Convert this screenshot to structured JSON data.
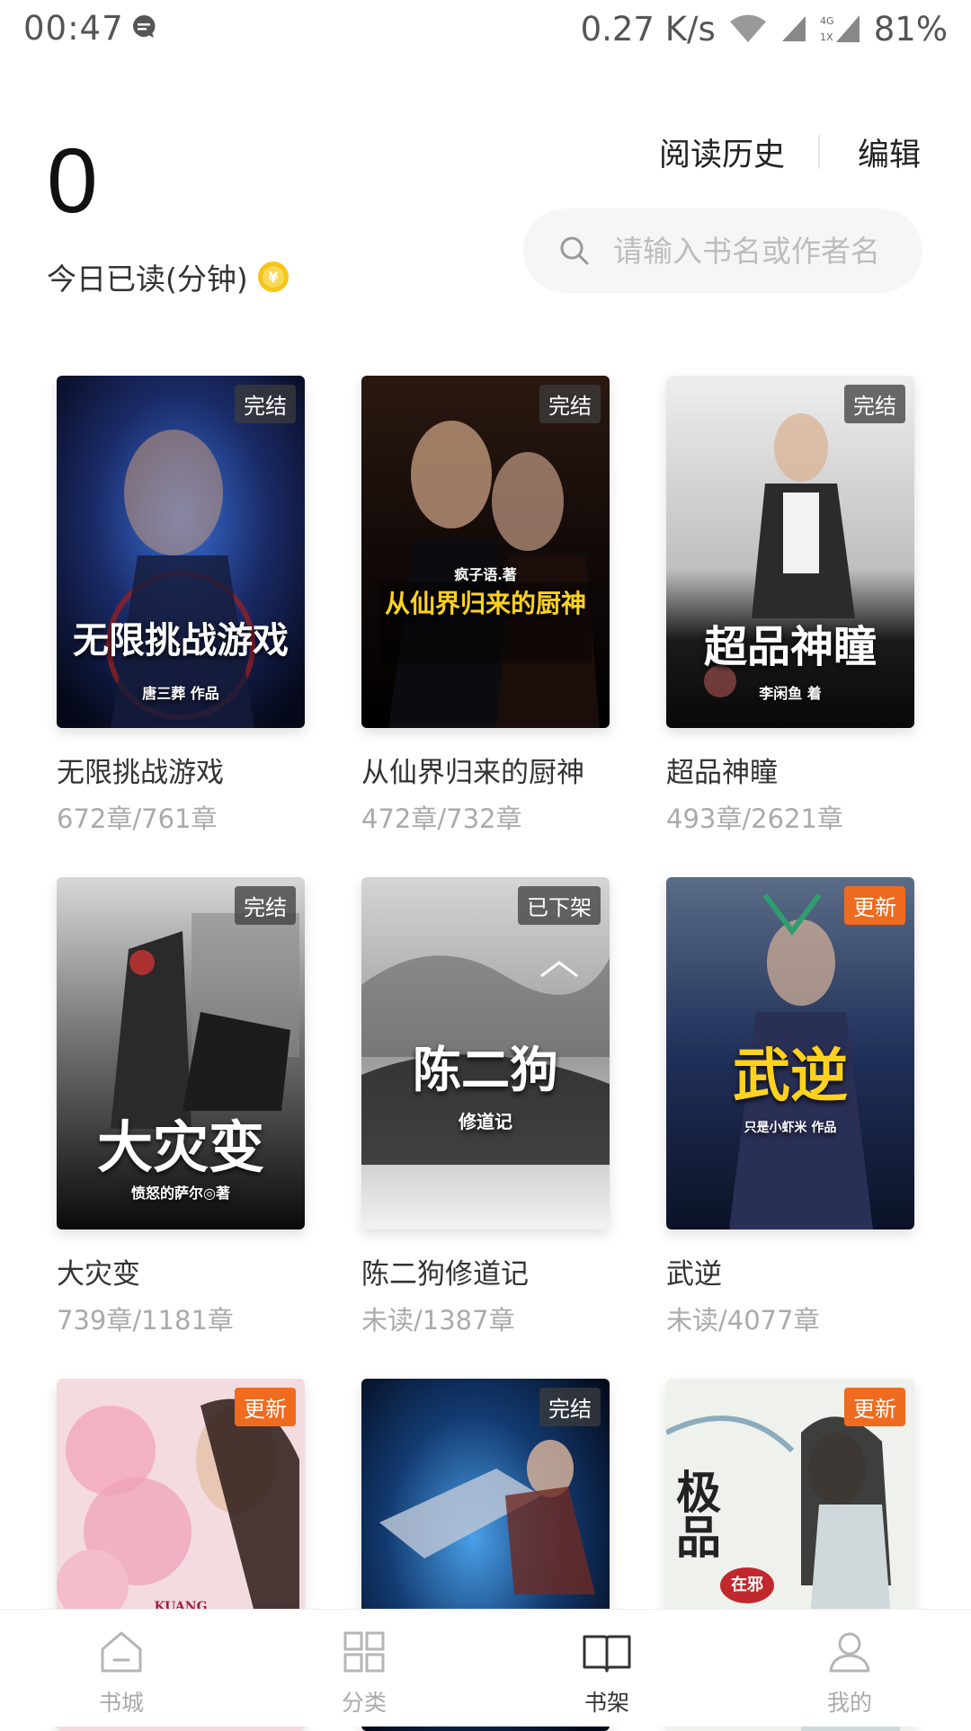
{
  "status_bar": {
    "time": "00:47",
    "net_speed": "0.27 K/s",
    "network_type": "4G",
    "network_sub": "1X",
    "battery": "81%"
  },
  "header": {
    "minutes_value": "0",
    "minutes_label": "今日已读(分钟)",
    "history_label": "阅读历史",
    "edit_label": "编辑",
    "search_placeholder": "请输入书名或作者名"
  },
  "books": [
    {
      "title": "无限挑战游戏",
      "progress": "672章/761章",
      "badge": "完结",
      "badge_type": "done",
      "cover_text": "无限挑战游戏",
      "cover_sub": "唐三葬 作品"
    },
    {
      "title": "从仙界归来的厨神",
      "progress": "472章/732章",
      "badge": "完结",
      "badge_type": "done",
      "cover_text": "从仙界归来的厨神",
      "cover_sub": "疯子语.著"
    },
    {
      "title": "超品神瞳",
      "progress": "493章/2621章",
      "badge": "完结",
      "badge_type": "done",
      "cover_text": "超品神瞳",
      "cover_sub": "李闲鱼 着"
    },
    {
      "title": "大灾变",
      "progress": "739章/1181章",
      "badge": "完结",
      "badge_type": "done",
      "cover_text": "大灾变",
      "cover_sub": "愤怒的萨尔◎著"
    },
    {
      "title": "陈二狗修道记",
      "progress": "未读/1387章",
      "badge": "已下架",
      "badge_type": "done",
      "cover_text": "陈二狗",
      "cover_sub": "修道记"
    },
    {
      "title": "武逆",
      "progress": "未读/4077章",
      "badge": "更新",
      "badge_type": "update",
      "cover_text": "武逆",
      "cover_sub": "只是小虾米 作品"
    },
    {
      "title": "",
      "progress": "",
      "badge": "更新",
      "badge_type": "update",
      "cover_text": "",
      "cover_sub": "KUANG"
    },
    {
      "title": "",
      "progress": "",
      "badge": "完结",
      "badge_type": "done",
      "cover_text": "",
      "cover_sub": ""
    },
    {
      "title": "",
      "progress": "",
      "badge": "更新",
      "badge_type": "update",
      "cover_text": "极品",
      "cover_sub": "在邪"
    }
  ],
  "nav": [
    {
      "label": "书城",
      "icon": "bookstore-icon",
      "active": false
    },
    {
      "label": "分类",
      "icon": "category-icon",
      "active": false
    },
    {
      "label": "书架",
      "icon": "bookshelf-icon",
      "active": true
    },
    {
      "label": "我的",
      "icon": "profile-icon",
      "active": false
    }
  ],
  "colors": {
    "accent_badge": "#ef6b1f",
    "coin": "#f5c518"
  }
}
